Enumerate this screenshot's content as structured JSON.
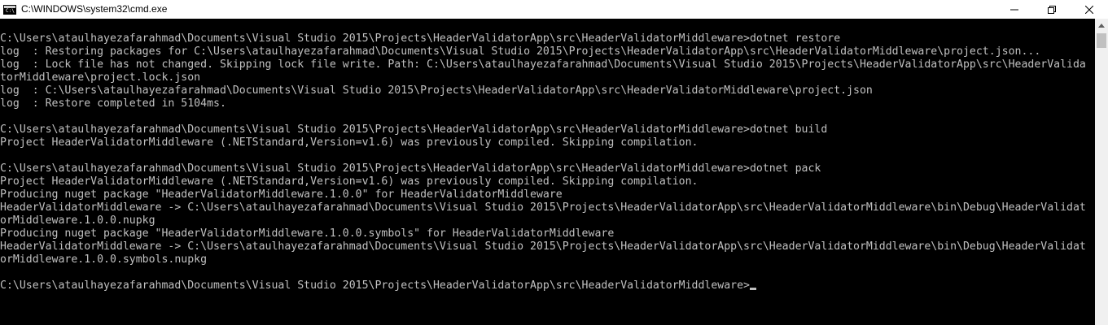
{
  "window": {
    "title": "C:\\WINDOWS\\system32\\cmd.exe",
    "icon": "cmd-icon"
  },
  "console": {
    "text_color": "#c0c0c0",
    "background": "#000000",
    "lines": [
      "C:\\Users\\ataulhayezafarahmad\\Documents\\Visual Studio 2015\\Projects\\HeaderValidatorApp\\src\\HeaderValidatorMiddleware>dotnet restore",
      "log  : Restoring packages for C:\\Users\\ataulhayezafarahmad\\Documents\\Visual Studio 2015\\Projects\\HeaderValidatorApp\\src\\HeaderValidatorMiddleware\\project.json...",
      "log  : Lock file has not changed. Skipping lock file write. Path: C:\\Users\\ataulhayezafarahmad\\Documents\\Visual Studio 2015\\Projects\\HeaderValidatorApp\\src\\HeaderValida",
      "torMiddleware\\project.lock.json",
      "log  : C:\\Users\\ataulhayezafarahmad\\Documents\\Visual Studio 2015\\Projects\\HeaderValidatorApp\\src\\HeaderValidatorMiddleware\\project.json",
      "log  : Restore completed in 5104ms.",
      "",
      "C:\\Users\\ataulhayezafarahmad\\Documents\\Visual Studio 2015\\Projects\\HeaderValidatorApp\\src\\HeaderValidatorMiddleware>dotnet build",
      "Project HeaderValidatorMiddleware (.NETStandard,Version=v1.6) was previously compiled. Skipping compilation.",
      "",
      "C:\\Users\\ataulhayezafarahmad\\Documents\\Visual Studio 2015\\Projects\\HeaderValidatorApp\\src\\HeaderValidatorMiddleware>dotnet pack",
      "Project HeaderValidatorMiddleware (.NETStandard,Version=v1.6) was previously compiled. Skipping compilation.",
      "Producing nuget package \"HeaderValidatorMiddleware.1.0.0\" for HeaderValidatorMiddleware",
      "HeaderValidatorMiddleware -> C:\\Users\\ataulhayezafarahmad\\Documents\\Visual Studio 2015\\Projects\\HeaderValidatorApp\\src\\HeaderValidatorMiddleware\\bin\\Debug\\HeaderValidat",
      "orMiddleware.1.0.0.nupkg",
      "Producing nuget package \"HeaderValidatorMiddleware.1.0.0.symbols\" for HeaderValidatorMiddleware",
      "HeaderValidatorMiddleware -> C:\\Users\\ataulhayezafarahmad\\Documents\\Visual Studio 2015\\Projects\\HeaderValidatorApp\\src\\HeaderValidatorMiddleware\\bin\\Debug\\HeaderValidat",
      "orMiddleware.1.0.0.symbols.nupkg",
      "",
      "C:\\Users\\ataulhayezafarahmad\\Documents\\Visual Studio 2015\\Projects\\HeaderValidatorApp\\src\\HeaderValidatorMiddleware>"
    ]
  }
}
